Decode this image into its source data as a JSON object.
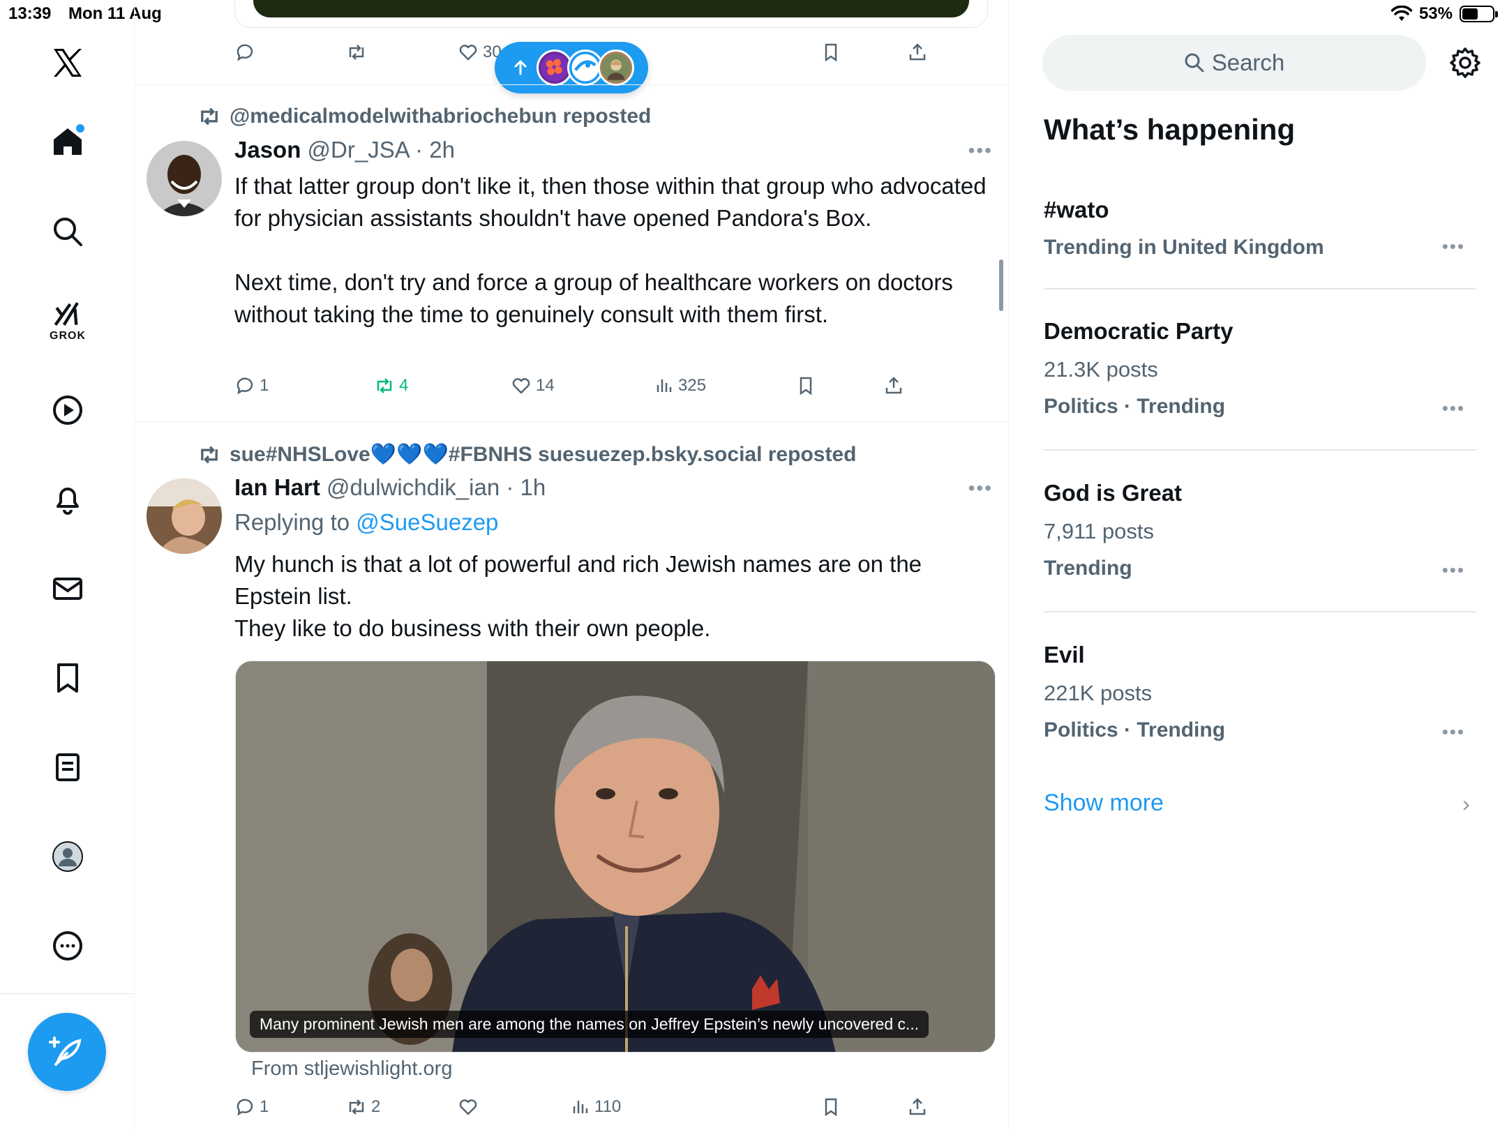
{
  "status_bar": {
    "time": "13:39",
    "date": "Mon 11 Aug",
    "battery": "53%",
    "battery_level": 0.53
  },
  "nav": {
    "grok_label": "GROK"
  },
  "timeline": {
    "prev_post_actions": {
      "like_count": "30"
    },
    "post1": {
      "repost_by": "@medicalmodelwithabriochebun reposted",
      "name": "Jason",
      "handle_time": "@Dr_JSA · 2h",
      "text_p1": "If that latter group don't like it, then those within that group who advocated for physician assistants shouldn't have opened Pandora's Box.",
      "text_p2": "Next time, don't try and force a group of healthcare workers on doctors without taking the time to genuinely consult with them first.",
      "replies": "1",
      "reposts": "4",
      "likes": "14",
      "views": "325"
    },
    "post2": {
      "repost_by": "sue#NHSLove💙💙💙#FBNHS suesuezep.bsky.social reposted",
      "name": "Ian Hart",
      "handle_time": "@dulwichdik_ian · 1h",
      "replying_label": "Replying to ",
      "replying_handle": "@SueSuezep",
      "text_l1": "My hunch is that a lot of powerful and rich Jewish names are on the Epstein list.",
      "text_l2": "They like to do business with their own people.",
      "media_caption": "Many prominent Jewish men are among the names on Jeffrey Epstein’s newly uncovered c...",
      "media_source": "From stljewishlight.org",
      "replies": "1",
      "reposts": "2",
      "views": "110"
    }
  },
  "right": {
    "search_placeholder": "Search",
    "section_title": "What’s happening",
    "trends": [
      {
        "name": "#wato",
        "meta": "",
        "sub": "Trending in United Kingdom"
      },
      {
        "name": "Democratic Party",
        "meta": "21.3K posts",
        "sub": "Politics · Trending"
      },
      {
        "name": "God is Great",
        "meta": "7,911 posts",
        "sub": "Trending"
      },
      {
        "name": "Evil",
        "meta": "221K posts",
        "sub": "Politics · Trending"
      }
    ],
    "show_more": "Show more"
  },
  "colors": {
    "accent": "#1d9bf0",
    "repost_green": "#00ba7c",
    "muted": "#536471"
  }
}
